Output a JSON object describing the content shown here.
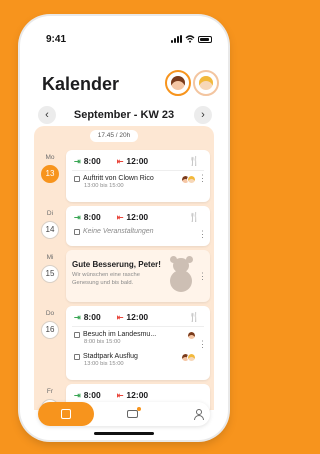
{
  "status_bar": {
    "time": "9:41"
  },
  "header": {
    "title": "Kalender"
  },
  "week": {
    "title": "September - KW 23",
    "prev_icon": "chevron-left-icon",
    "next_icon": "chevron-right-icon"
  },
  "time_range": "17.45 / 20h",
  "days": [
    {
      "name": "Mo",
      "number": "13",
      "today": true,
      "checkin": "8:00",
      "checkout": "12:00",
      "meal": true,
      "events": [
        {
          "title": "Auftritt von Clown Rico",
          "time": "13:00 bis 15:00"
        }
      ]
    },
    {
      "name": "Di",
      "number": "14",
      "today": false,
      "checkin": "8:00",
      "checkout": "12:00",
      "meal": false,
      "no_events": "Keine Veranstaltungen"
    },
    {
      "name": "Mi",
      "number": "15",
      "today": false,
      "message_title": "Gute Besserung, Peter!",
      "message_text": "Wir wünschen eine rasche Genesung und bis bald."
    },
    {
      "name": "Do",
      "number": "16",
      "today": false,
      "checkin": "8:00",
      "checkout": "12:00",
      "meal": true,
      "events": [
        {
          "title": "Besuch im Landesmu...",
          "time": "8:00 bis 15:00"
        },
        {
          "title": "Stadtpark Ausflug",
          "time": "13:00 bis 15:00"
        }
      ]
    },
    {
      "name": "Fr",
      "number": "17",
      "today": false,
      "checkin": "8:00",
      "checkout": "12:00"
    }
  ],
  "colors": {
    "accent": "#f7941d",
    "checkin": "#3aa655",
    "checkout": "#e8463b",
    "background": "#fde7d3"
  },
  "tabs": [
    {
      "name": "calendar",
      "icon": "calendar-icon",
      "active": true
    },
    {
      "name": "inbox",
      "icon": "inbox-icon",
      "active": false,
      "badge": true
    },
    {
      "name": "profile",
      "icon": "person-icon",
      "active": false
    }
  ]
}
